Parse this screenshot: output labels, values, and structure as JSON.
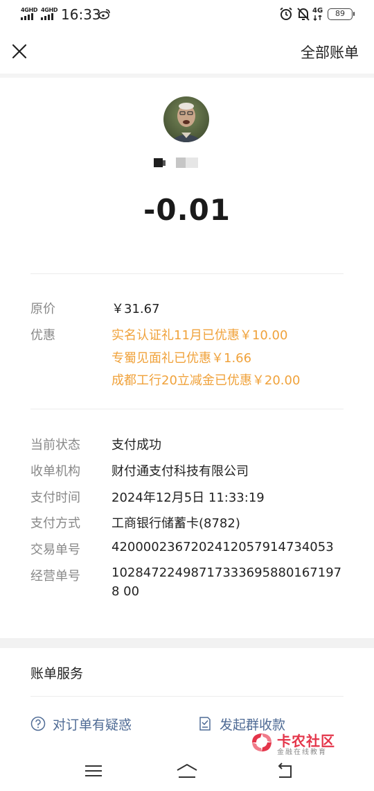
{
  "status_bar": {
    "signal_1": "4GHD",
    "signal_2": "4GHD",
    "time": "16:33",
    "network": "4G",
    "battery": "89",
    "icons": [
      "weibo-icon",
      "alarm-icon",
      "mute-bell-icon",
      "network-icon",
      "battery-icon"
    ]
  },
  "nav": {
    "close_icon": "close-icon",
    "all_bills": "全部账单"
  },
  "payment": {
    "amount": "-0.01"
  },
  "pricing": {
    "original_label": "原价",
    "original_value": "￥31.67",
    "discount_label": "优惠",
    "discounts": [
      "实名认证礼11月已优惠￥10.00",
      "专蜀见面礼已优惠￥1.66",
      "成都工行20立减金已优惠￥20.00"
    ]
  },
  "details": [
    {
      "label": "当前状态",
      "value": "支付成功"
    },
    {
      "label": "收单机构",
      "value": "财付通支付科技有限公司"
    },
    {
      "label": "支付时间",
      "value": "2024年12月5日 11:33:19"
    },
    {
      "label": "支付方式",
      "value": "工商银行储蓄卡(8782)"
    },
    {
      "label": "交易单号",
      "value": "4200002367202412057914734053"
    },
    {
      "label": "经营单号",
      "value": "102847224987173336958801671978 00"
    }
  ],
  "services": {
    "title": "账单服务",
    "items": [
      {
        "label": "对订单有疑惑",
        "icon": "question-icon"
      },
      {
        "label": "发起群收款",
        "icon": "receipt-icon"
      }
    ]
  },
  "watermark": {
    "title": "卡农社区",
    "subtitle": "金融在线教育"
  },
  "colors": {
    "discount": "#f0a23b",
    "link": "#4f6b95",
    "watermark": "#e4354a"
  }
}
